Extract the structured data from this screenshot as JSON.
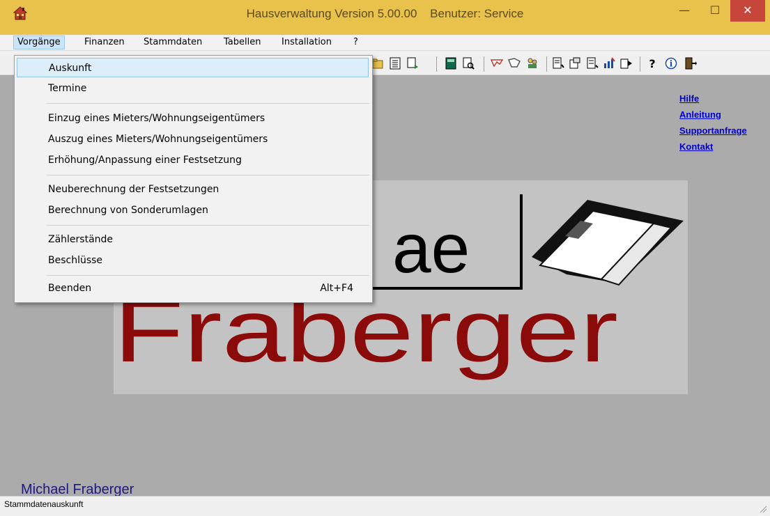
{
  "window": {
    "title": "Hausverwaltung Version 5.00.00",
    "user": "Benutzer: Service",
    "minimize_glyph": "—",
    "maximize_glyph": "☐",
    "close_glyph": "✕"
  },
  "menubar": {
    "items": [
      {
        "label": "Vorgänge"
      },
      {
        "label": "Finanzen"
      },
      {
        "label": "Stammdaten"
      },
      {
        "label": "Tabellen"
      },
      {
        "label": "Installation"
      },
      {
        "label": "?"
      }
    ]
  },
  "dropdown": {
    "items": [
      {
        "label": "Auskunft"
      },
      {
        "label": "Termine"
      },
      {
        "label": "Einzug eines Mieters/Wohnungseigentümers"
      },
      {
        "label": "Auszug eines Mieters/Wohnungseigentümers"
      },
      {
        "label": "Erhöhung/Anpassung einer Festsetzung"
      },
      {
        "label": "Neuberechnung der Festsetzungen"
      },
      {
        "label": "Berechnung von Sonderumlagen"
      },
      {
        "label": "Zählerstände"
      },
      {
        "label": "Beschlüsse"
      },
      {
        "label": "Beenden",
        "accelerator": "Alt+F4"
      }
    ]
  },
  "links": {
    "help": "Hilfe",
    "manual": "Anleitung",
    "support": "Supportanfrage",
    "contact": "Kontakt"
  },
  "logo": {
    "top_text": "ae",
    "bottom_text": "Fraberger"
  },
  "footer_name": "Michael Fraberger",
  "statusbar": {
    "text": "Stammdatenauskunft"
  },
  "colors": {
    "titlebar": "#e8c24a",
    "workspace": "#ababab",
    "logo_red": "#8b0a0a",
    "link_blue": "#0000d0"
  }
}
